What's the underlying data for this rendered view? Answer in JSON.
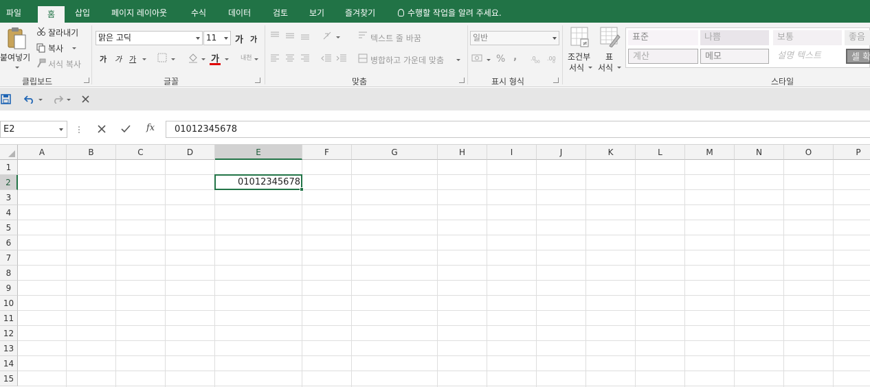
{
  "ribbon_tabs": [
    "파일",
    "홈",
    "삽입",
    "페이지 레이아웃",
    "수식",
    "데이터",
    "검토",
    "보기",
    "즐겨찾기"
  ],
  "active_tab": "홈",
  "tell_me": "수행할 작업을 알려 주세요.",
  "clipboard": {
    "paste": "붙여넣기",
    "cut": "잘라내기",
    "copy": "복사",
    "format_painter": "서식 복사",
    "group_label": "클립보드"
  },
  "font": {
    "name": "맑은 고딕",
    "size": "11",
    "grow_glyph": "가",
    "shrink_glyph": "가",
    "bold_glyph": "가",
    "italic_glyph": "가",
    "underline_glyph": "가",
    "font_color_glyph": "가",
    "phonetic_glyph": "내천",
    "group_label": "글꼴"
  },
  "alignment": {
    "wrap_text": "텍스트 줄 바꿈",
    "merge_center": "병합하고 가운데 맞춤",
    "group_label": "맞춤"
  },
  "number": {
    "format": "일반",
    "percent": "%",
    "comma": ",",
    "group_label": "표시 형식"
  },
  "styles_group": {
    "conditional_format": [
      "조건부",
      "서식"
    ],
    "format_as_table": [
      "표",
      "서식"
    ],
    "cells": [
      "표준",
      "나쁨",
      "보통",
      "좋음",
      "계산",
      "메모",
      "설명 텍스트",
      "셀 확"
    ],
    "group_label": "스타일"
  },
  "formula_bar": {
    "name_box": "E2",
    "fx": "fx",
    "content": "01012345678"
  },
  "grid": {
    "columns": [
      "A",
      "B",
      "C",
      "D",
      "E",
      "F",
      "G",
      "H",
      "I",
      "J",
      "K",
      "L",
      "M",
      "N",
      "O",
      "P"
    ],
    "rows": [
      "1",
      "2",
      "3",
      "4",
      "5",
      "6",
      "7",
      "8",
      "9",
      "10",
      "11",
      "12",
      "13",
      "14",
      "15"
    ],
    "selected_column": "E",
    "selected_row": "2",
    "active_cell_value": "01012345678"
  },
  "colors": {
    "accent": "#217346",
    "ribbon_bg": "#f3f3f3",
    "qat_bg": "#e6e6e6",
    "grid_line": "#dedede",
    "save_icon": "#1e64b4",
    "undo_icon": "#1e64b4",
    "font_color_bar": "#e00000"
  }
}
